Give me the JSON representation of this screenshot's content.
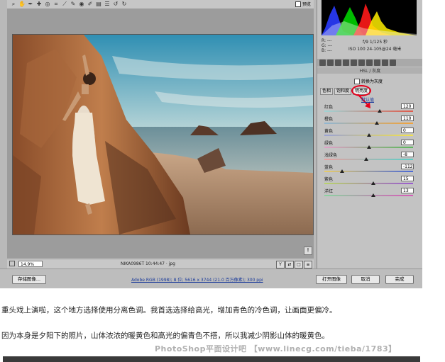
{
  "toolbar": {
    "icons": [
      "zoom-icon",
      "hand-icon",
      "white-balance-icon",
      "color-sampler-icon",
      "target-adjust-icon",
      "crop-icon",
      "straighten-icon",
      "spot-removal-icon",
      "red-eye-icon",
      "adjustment-brush-icon",
      "graduated-filter-icon",
      "preferences-icon",
      "rotate-ccw-icon",
      "rotate-cw-icon"
    ],
    "preview_label": "预览"
  },
  "statusbar": {
    "zoom": "14.9%",
    "filename": "NIKA0986T 10:44:47 · jpg"
  },
  "bottombar": {
    "save": "存储图像...",
    "workflow": "Adobe RGB (1998); 8 位; 5616 x 3744 (21.0 百万像素); 300 ppi",
    "open": "打开图像",
    "cancel": "取消",
    "done": "完成"
  },
  "readout": {
    "r": "R:  ---",
    "g": "G:  ---",
    "b": "B:  ---",
    "exposure": "f/9   1/125 秒",
    "iso": "ISO 100   24-105@24 毫米"
  },
  "panel": {
    "title": "HSL / 灰度",
    "grayscale": "转换为灰度",
    "subtabs": [
      "色相",
      "饱和度",
      "明亮度"
    ],
    "default_link": "默认值"
  },
  "sliders": [
    {
      "label": "红色",
      "value": "120",
      "pos": 0.62,
      "track": "linear-gradient(90deg,#9fd4d6,#e05a4a)"
    },
    {
      "label": "橙色",
      "value": "110",
      "pos": 0.59,
      "track": "linear-gradient(90deg,#8fb6d4,#f2a33a)"
    },
    {
      "label": "黄色",
      "value": "0",
      "pos": 0.5,
      "track": "linear-gradient(90deg,#9aa2d6,#f3e24a)"
    },
    {
      "label": "绿色",
      "value": "0",
      "pos": 0.5,
      "track": "linear-gradient(90deg,#e0a0c8,#5ab85a)"
    },
    {
      "label": "浅绿色",
      "value": "-8",
      "pos": 0.47,
      "track": "linear-gradient(90deg,#e8a0a0,#5ad0c8)"
    },
    {
      "label": "蓝色",
      "value": "-112",
      "pos": 0.2,
      "track": "linear-gradient(90deg,#e8cc6a,#4a6ad8)"
    },
    {
      "label": "紫色",
      "value": "15",
      "pos": 0.55,
      "track": "linear-gradient(90deg,#b8d46a,#9a5ad0)"
    },
    {
      "label": "洋红",
      "value": "13",
      "pos": 0.55,
      "track": "linear-gradient(90deg,#8ad4a0,#d85ab8)"
    }
  ],
  "captions": {
    "line1": "重头戏上演啦，这个地方选择使用分离色调。我首选选择给高光，增加青色的冷色调，让画面更偏冷。",
    "line2": "因为本身是夕阳下的照片，山体浓浓的暖黄色和高光的偏青色不搭，所以我减少阴影山体的暖黄色。"
  },
  "watermark": "PhotoShop平面设计吧 【www.linecg.com/tieba/1783】",
  "colors": {
    "accent_red": "#e5001c",
    "link_blue": "#1a3a9a"
  }
}
